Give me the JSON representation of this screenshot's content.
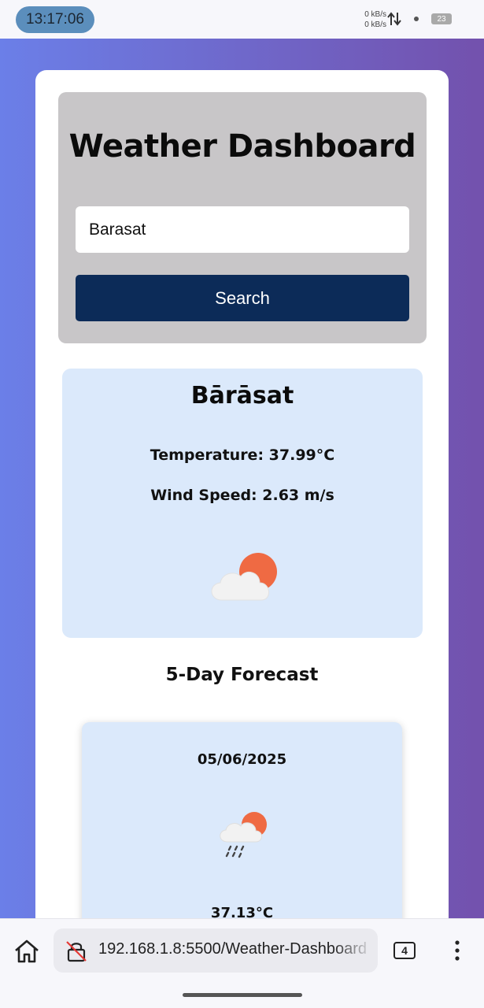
{
  "status_bar": {
    "time": "13:17:06",
    "net_up": "0 kB/s",
    "net_down": "0 kB/s",
    "battery": "23"
  },
  "app": {
    "title": "Weather Dashboard",
    "search": {
      "value": "Barasat",
      "button_label": "Search"
    }
  },
  "current": {
    "city": "Bārāsat",
    "temperature": "Temperature: 37.99°C",
    "wind": "Wind Speed: 2.63 m/s",
    "icon": "partly-cloudy-icon"
  },
  "forecast": {
    "title": "5-Day Forecast",
    "days": [
      {
        "date": "05/06/2025",
        "icon": "rain-cloud-sun-icon",
        "temp": "37.13°C"
      }
    ]
  },
  "browser": {
    "url": "192.168.1.8:5500/Weather-Dashboard",
    "tab_count": "4"
  },
  "colors": {
    "gradient_start": "#6b7fe8",
    "gradient_end": "#7351ad",
    "search_button": "#0c2b58",
    "card_bg": "#dbe9fb",
    "panel_bg": "#c8c6c8"
  }
}
